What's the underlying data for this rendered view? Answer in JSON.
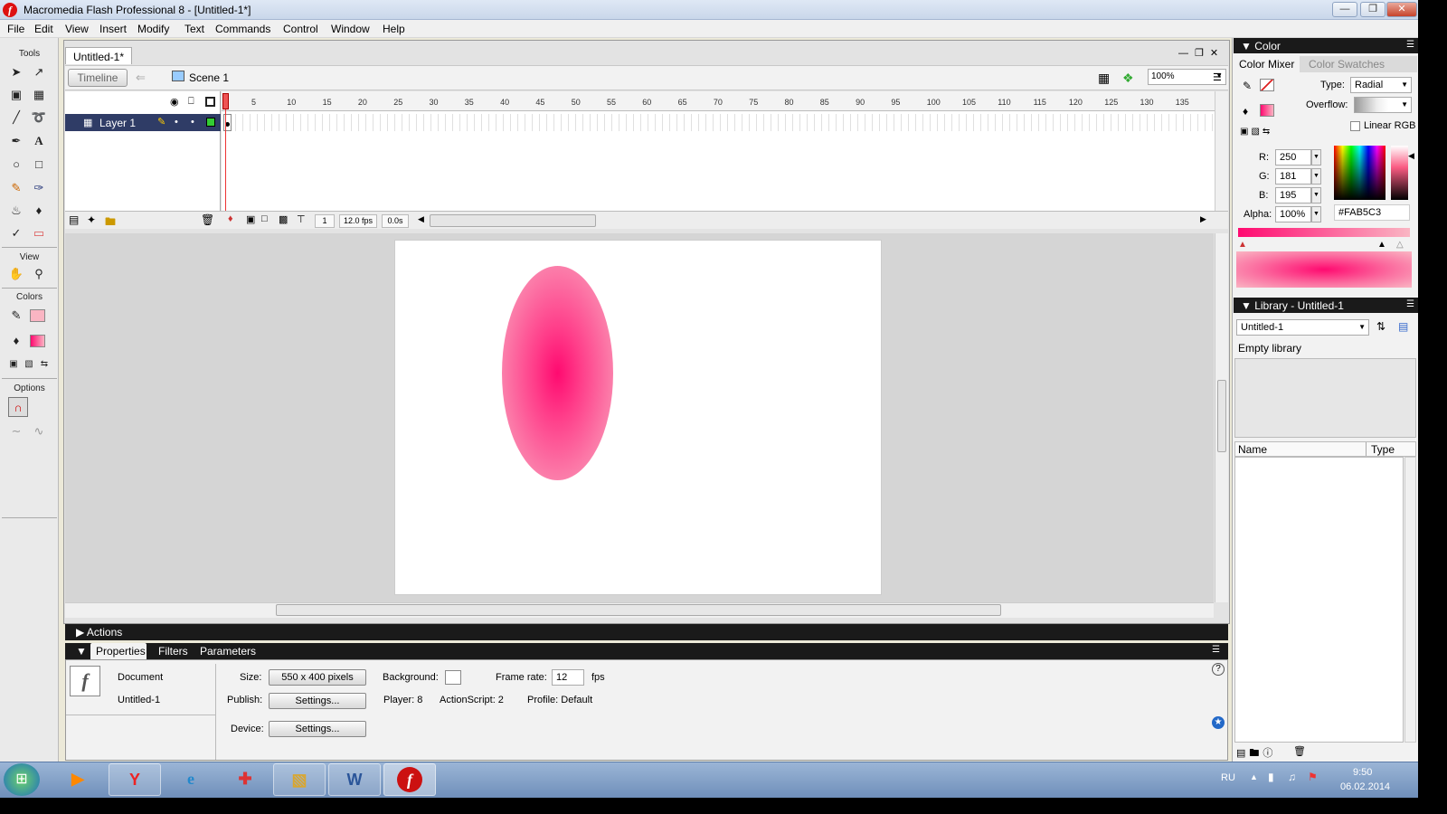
{
  "window": {
    "title": "Macromedia Flash Professional 8 - [Untitled-1*]",
    "app_icon": "f"
  },
  "menu": [
    "File",
    "Edit",
    "View",
    "Insert",
    "Modify",
    "Text",
    "Commands",
    "Control",
    "Window",
    "Help"
  ],
  "tools": {
    "header": "Tools",
    "view_header": "View",
    "colors_header": "Colors",
    "options_header": "Options"
  },
  "document": {
    "tab": "Untitled-1*",
    "timeline_button": "Timeline",
    "scene": "Scene 1",
    "zoom": "100%"
  },
  "timeline": {
    "ruler": [
      "5",
      "10",
      "15",
      "20",
      "25",
      "30",
      "35",
      "40",
      "45",
      "50",
      "55",
      "60",
      "65",
      "70",
      "75",
      "80",
      "85",
      "90",
      "95",
      "100",
      "105",
      "110",
      "115",
      "120",
      "125",
      "130",
      "135"
    ],
    "layer_name": "Layer 1",
    "current_frame": "1",
    "fps": "12.0 fps",
    "elapsed": "0.0s"
  },
  "panels": {
    "actions": "Actions",
    "properties_tabs": [
      "Properties",
      "Filters",
      "Parameters"
    ]
  },
  "properties": {
    "type_label": "Document",
    "doc_name": "Untitled-1",
    "size_label": "Size:",
    "size_value": "550 x 400 pixels",
    "background_label": "Background:",
    "framerate_label": "Frame rate:",
    "framerate_value": "12",
    "fps_unit": "fps",
    "publish_label": "Publish:",
    "settings_btn": "Settings...",
    "player": "Player: 8",
    "actionscript": "ActionScript:  2",
    "profile": "Profile:  Default",
    "device_label": "Device:",
    "device_btn": "Settings..."
  },
  "color_panel": {
    "header": "Color",
    "tab_mixer": "Color Mixer",
    "tab_swatches": "Color Swatches",
    "type_label": "Type:",
    "type_value": "Radial",
    "overflow_label": "Overflow:",
    "linear_rgb": "Linear RGB",
    "r_label": "R:",
    "r": "250",
    "g_label": "G:",
    "g": "181",
    "b_label": "B:",
    "b": "195",
    "alpha_label": "Alpha:",
    "alpha": "100%",
    "hex": "#FAB5C3"
  },
  "library": {
    "header": "Library - Untitled-1",
    "dropdown": "Untitled-1",
    "empty": "Empty library",
    "col_name": "Name",
    "col_type": "Type"
  },
  "taskbar": {
    "apps": [
      "media-player-icon",
      "yandex-browser-icon",
      "internet-explorer-icon",
      "antivirus-icon",
      "folder-icon",
      "word-icon",
      "flash-icon"
    ],
    "lang": "RU",
    "time": "9:50",
    "date": "06.02.2014"
  },
  "colors": {
    "accent": "#FAB5C3",
    "fill_center": "#FF0A70",
    "panel_header": "#1A1A1A"
  }
}
